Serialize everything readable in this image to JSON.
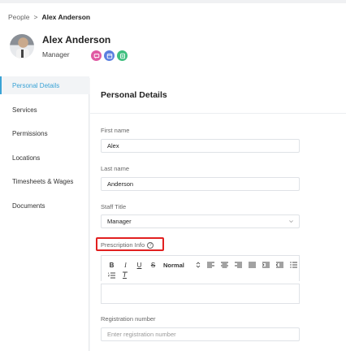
{
  "breadcrumb": {
    "parent": "People",
    "separator": ">",
    "current": "Alex Anderson"
  },
  "profile": {
    "name": "Alex Anderson",
    "role": "Manager"
  },
  "badges": [
    {
      "icon": "chat-icon",
      "color": "#e05aa3"
    },
    {
      "icon": "calendar-icon",
      "color": "#5b7fe0"
    },
    {
      "icon": "document-icon",
      "color": "#3fbf7f"
    }
  ],
  "sidebar": {
    "items": [
      {
        "label": "Personal Details",
        "active": true
      },
      {
        "label": "Services"
      },
      {
        "label": "Permissions"
      },
      {
        "label": "Locations"
      },
      {
        "label": "Timesheets & Wages"
      },
      {
        "label": "Documents"
      }
    ]
  },
  "main": {
    "title": "Personal Details",
    "first_name": {
      "label": "First name",
      "value": "Alex"
    },
    "last_name": {
      "label": "Last name",
      "value": "Anderson"
    },
    "staff_title": {
      "label": "Staff Title",
      "value": "Manager"
    },
    "prescription": {
      "label": "Prescription Info",
      "help": "?"
    },
    "toolbar": {
      "bold": "B",
      "italic": "I",
      "underline": "U",
      "strike": "S",
      "format": "Normal"
    },
    "registration": {
      "label": "Registration number",
      "placeholder": "Enter registration number"
    }
  },
  "colors": {
    "accent": "#3aa3d6",
    "highlight": "#e22020"
  }
}
